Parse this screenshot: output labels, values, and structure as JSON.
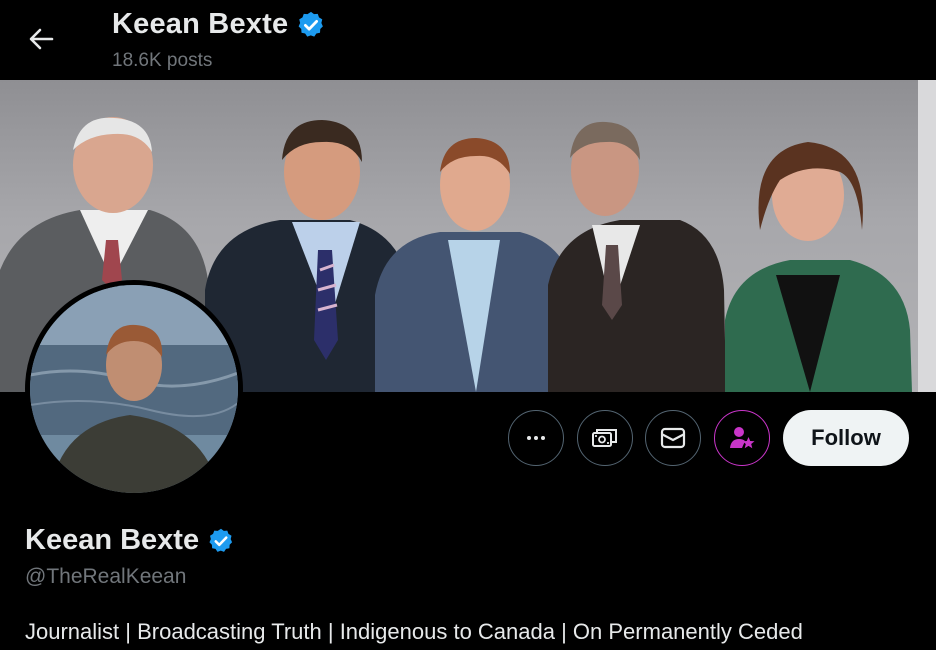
{
  "header": {
    "title": "Keean Bexte",
    "post_count": "18.6K posts"
  },
  "profile": {
    "display_name": "Keean Bexte",
    "handle": "@TheRealKeean",
    "bio": "Journalist | Broadcasting Truth | Indigenous to Canada | On Permanently Ceded",
    "verified": true
  },
  "actions": {
    "more_icon": "more-icon",
    "subscribe_icon": "subscribe-icon",
    "message_icon": "mail-icon",
    "notify_icon": "person-star-icon",
    "follow_label": "Follow"
  },
  "colors": {
    "verified_badge": "#1d9bf0",
    "notify_accent": "#c935c9",
    "follow_bg": "#eff3f4"
  }
}
